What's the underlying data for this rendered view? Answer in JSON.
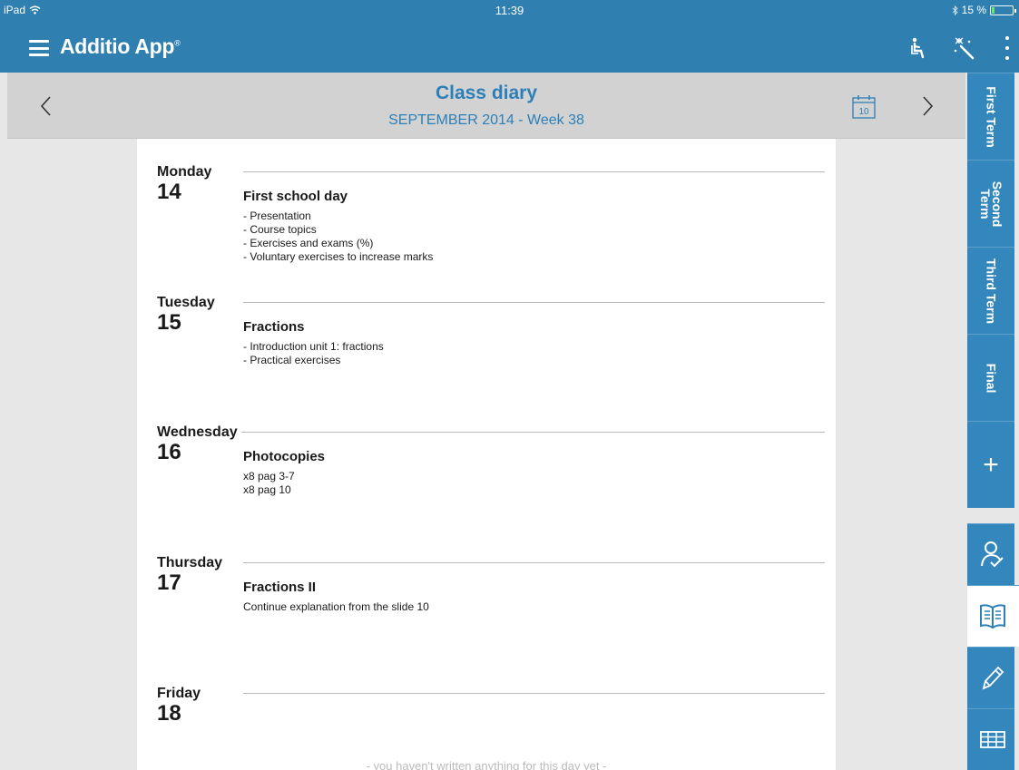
{
  "status_bar": {
    "device": "iPad",
    "time": "11:39",
    "battery": "15 %",
    "battery_level": 0.15
  },
  "app": {
    "title": "Additio App",
    "trademark": "®"
  },
  "header": {
    "title": "Class diary",
    "subtitle": "SEPTEMBER 2014 - Week 38",
    "calendar_day": "10"
  },
  "days": [
    {
      "name": "Monday",
      "number": "14",
      "title": "First school day",
      "lines": [
        "- Presentation",
        "- Course topics",
        "- Exercises and exams (%)",
        "- Voluntary exercises to increase marks"
      ]
    },
    {
      "name": "Tuesday",
      "number": "15",
      "title": "Fractions",
      "lines": [
        "- Introduction unit 1: fractions",
        "- Practical exercises"
      ]
    },
    {
      "name": "Wednesday",
      "number": "16",
      "title": "Photocopies",
      "lines": [
        "x8 pag 3-7",
        "x8 pag 10"
      ]
    },
    {
      "name": "Thursday",
      "number": "17",
      "title": "Fractions II",
      "lines": [
        "Continue explanation from the slide 10"
      ]
    },
    {
      "name": "Friday",
      "number": "18",
      "title": "",
      "lines": []
    }
  ],
  "empty_note": "- you haven't written anything for this day yet -",
  "side_tabs": {
    "terms": [
      "First Term",
      "Second Term",
      "Third Term",
      "Final"
    ],
    "add": "+",
    "icons": [
      "students-icon",
      "diary-book-icon",
      "pencil-icon",
      "grid-table-icon"
    ]
  },
  "colors": {
    "primary": "#2f7fb1",
    "header_gray": "#d2d2d2",
    "title_blue": "#2d7fb8",
    "tab_blue": "#3487bc"
  }
}
